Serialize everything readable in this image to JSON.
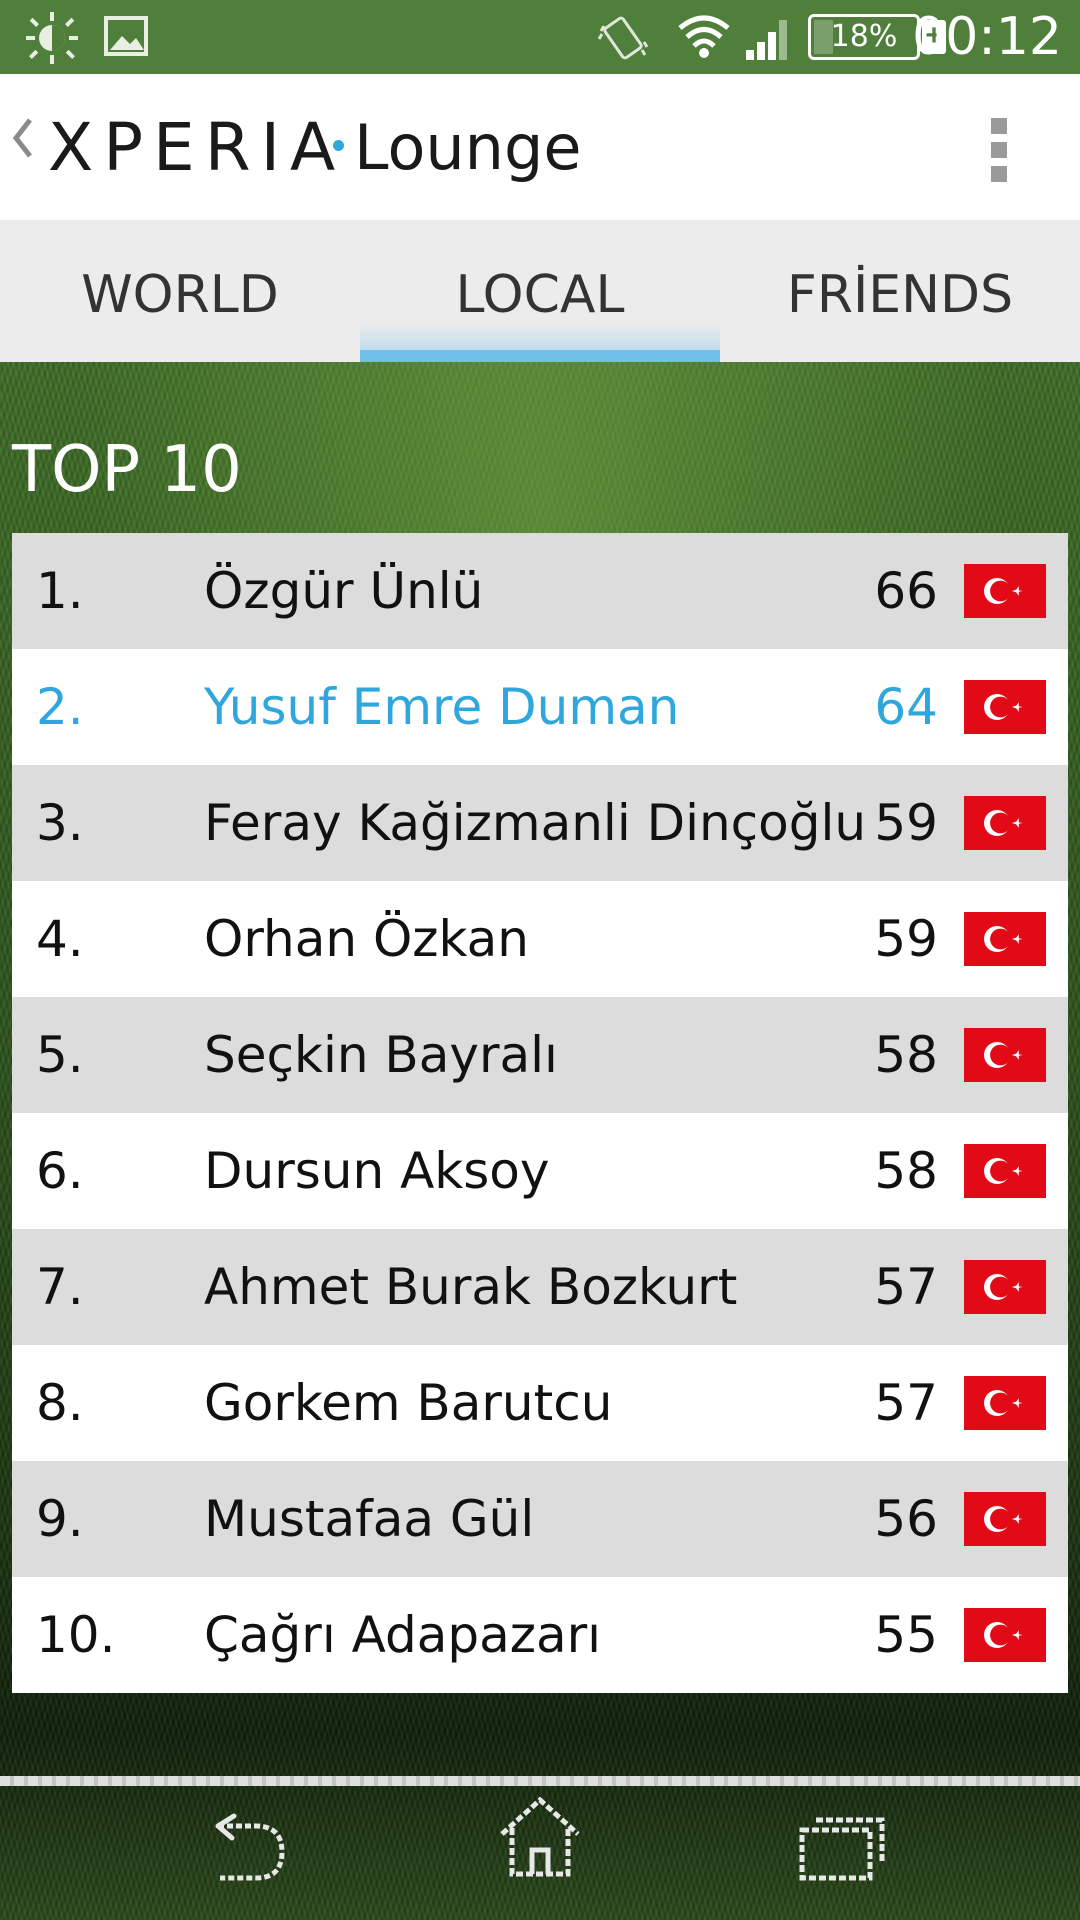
{
  "status_bar": {
    "icons": [
      "brightness-icon",
      "gallery-notification-icon",
      "vibrate-icon",
      "wifi-icon",
      "signal-icon"
    ],
    "battery": "18%",
    "time": "00:12"
  },
  "action_bar": {
    "brand": "XPERIA",
    "app_name": "Lounge",
    "accent_color": "#2fa7dc"
  },
  "tabs": [
    {
      "label": "WORLD",
      "active": false
    },
    {
      "label": "LOCAL",
      "active": true
    },
    {
      "label": "FRİENDS",
      "active": false
    }
  ],
  "leaderboard": {
    "title": "TOP 10",
    "rows": [
      {
        "rank": "1.",
        "name": "Özgür Ünlü",
        "score": "66",
        "flag": "turkey-flag-icon"
      },
      {
        "rank": "2.",
        "name": "Yusuf Emre Duman",
        "score": "64",
        "flag": "turkey-flag-icon",
        "highlight": true
      },
      {
        "rank": "3.",
        "name": "Feray Kağizmanli Dinçoğlu",
        "score": "59",
        "flag": "turkey-flag-icon"
      },
      {
        "rank": "4.",
        "name": "Orhan Özkan",
        "score": "59",
        "flag": "turkey-flag-icon"
      },
      {
        "rank": "5.",
        "name": "Seçkin Bayralı",
        "score": "58",
        "flag": "turkey-flag-icon"
      },
      {
        "rank": "6.",
        "name": "Dursun Aksoy",
        "score": "58",
        "flag": "turkey-flag-icon"
      },
      {
        "rank": "7.",
        "name": "Ahmet Burak Bozkurt",
        "score": "57",
        "flag": "turkey-flag-icon"
      },
      {
        "rank": "8.",
        "name": "Gorkem Barutcu",
        "score": "57",
        "flag": "turkey-flag-icon"
      },
      {
        "rank": "9.",
        "name": "Mustafaa Gül",
        "score": "56",
        "flag": "turkey-flag-icon"
      },
      {
        "rank": "10.",
        "name": "Çağrı Adapazarı",
        "score": "55",
        "flag": "turkey-flag-icon"
      }
    ]
  },
  "nav_bar": {
    "icons": [
      "back-icon",
      "home-icon",
      "recent-apps-icon"
    ]
  }
}
